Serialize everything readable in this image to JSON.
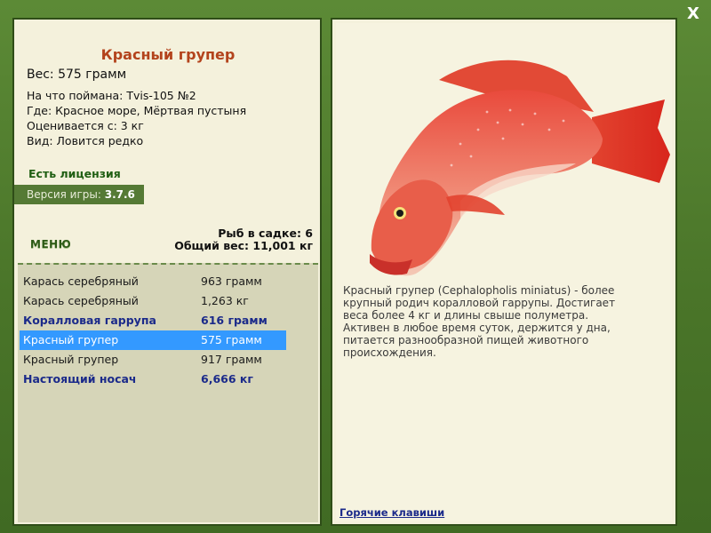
{
  "window": {
    "close_label": "X"
  },
  "fish": {
    "title": "Красный групер",
    "weight_line": "Вес: 575 грамм",
    "caught_with": "На что поймана: Tvis-105 №2",
    "location": "Где: Красное море, Мёртвая пустыня",
    "rated_from": "Оценивается с: 3 кг",
    "rarity": "Вид: Ловится редко",
    "description": "Красный групер (Cephalopholis miniatus) - более крупный родич коралловой гаррупы. Достигает веса более 4 кг и длины свыше полуметра. Активен в любое время суток, держится у дна, питается разнообразной пищей животного происхождения."
  },
  "license": "Есть лицензия",
  "version": {
    "label": "Версия игры:",
    "value": "3.7.6"
  },
  "menu_label": "МЕНЮ",
  "cage": {
    "count_line": "Рыб в садке: 6",
    "total_line": "Общий вес: 11,001 кг"
  },
  "catches": [
    {
      "name": "Карась серебряный",
      "weight": "963 грамм",
      "rare": false,
      "selected": false
    },
    {
      "name": "Карась серебряный",
      "weight": "1,263 кг",
      "rare": false,
      "selected": false
    },
    {
      "name": "Коралловая гаррупа",
      "weight": "616 грамм",
      "rare": true,
      "selected": false
    },
    {
      "name": "Красный групер",
      "weight": "575 грамм",
      "rare": false,
      "selected": true
    },
    {
      "name": "Красный групер",
      "weight": "917 грамм",
      "rare": false,
      "selected": false
    },
    {
      "name": "Настоящий носач",
      "weight": "6,666 кг",
      "rare": true,
      "selected": false
    }
  ],
  "hotkeys_label": "Горячие клавиши",
  "colors": {
    "frame": "#4e7a2f",
    "panel": "#f4f1dc",
    "title": "#b3431c",
    "selected": "#3399ff",
    "rare": "#1b2a8a"
  }
}
